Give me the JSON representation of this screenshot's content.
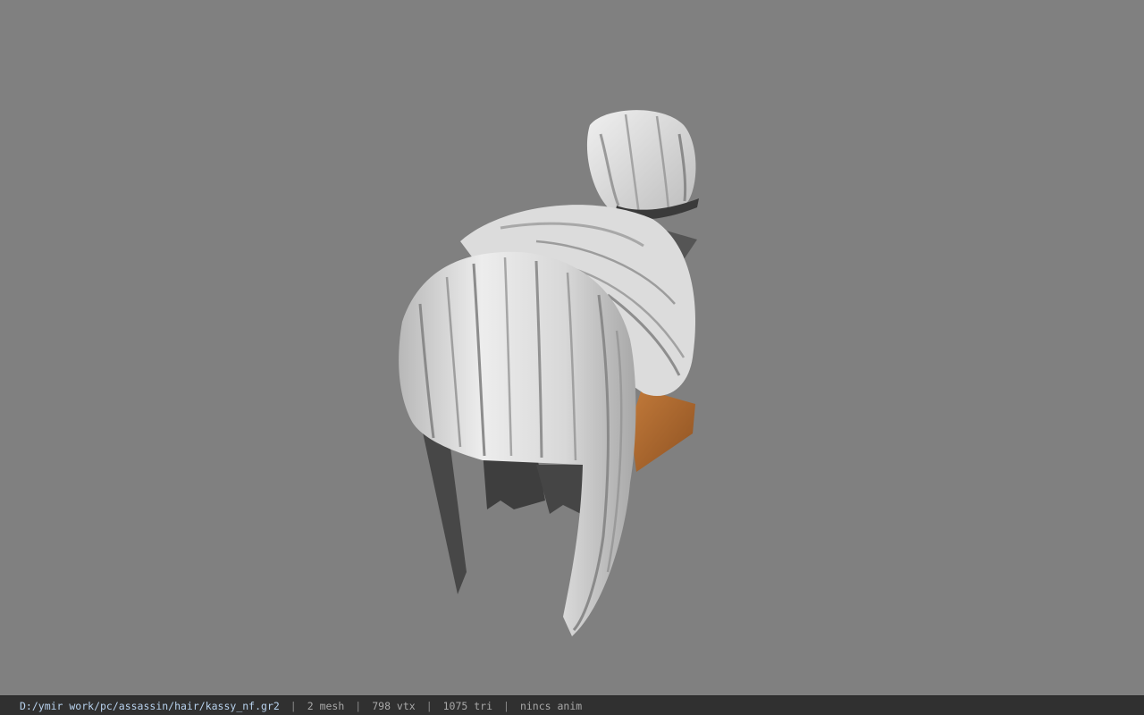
{
  "viewport": {
    "background_color": "#808080",
    "model": "hair-mesh"
  },
  "statusbar": {
    "file_path": "D:/ymir work/pc/assassin/hair/kassy_nf.gr2",
    "separator": "|",
    "mesh_count": "2 mesh",
    "vertex_count": "798 vtx",
    "triangle_count": "1075 tri",
    "anim_status": "nincs anim"
  },
  "colors": {
    "hair_light": "#e4e4e4",
    "hair_shadow": "#9a9a9a",
    "hair_dark": "#4a4a4a",
    "skin": "#b06a30",
    "path_text": "#b8d2ee"
  }
}
